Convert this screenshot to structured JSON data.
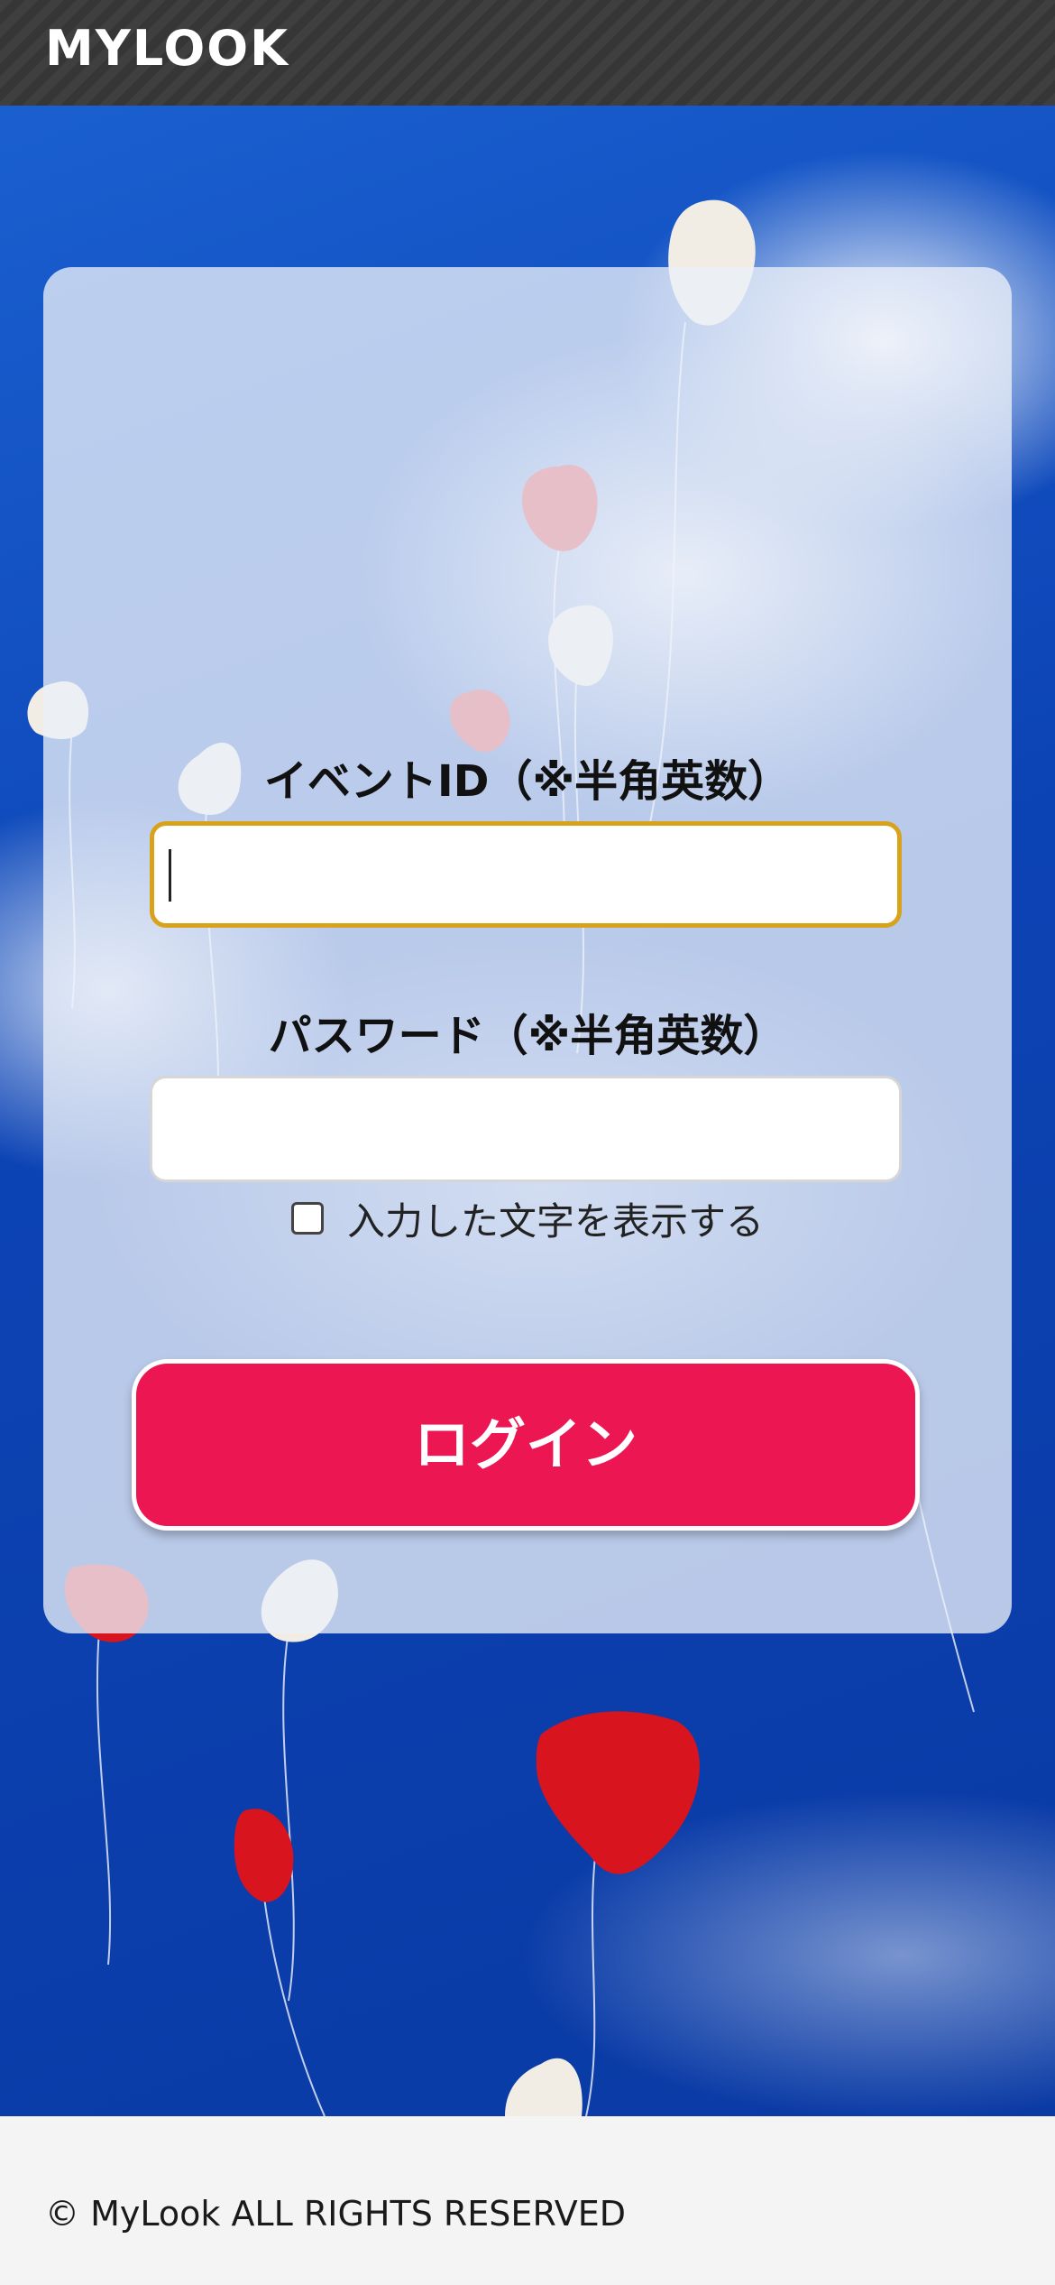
{
  "header": {
    "brand": "MYLOOK"
  },
  "form": {
    "event_id_label": "イベントID（※半角英数）",
    "event_id_value": "",
    "password_label": "パスワード（※半角英数）",
    "password_value": "",
    "show_password_label": "入力した文字を表示する",
    "show_password_checked": false,
    "login_label": "ログイン"
  },
  "footer": {
    "copyright": "© MyLook ALL RIGHTS RESERVED"
  },
  "colors": {
    "header_bg": "#3a3a3a",
    "login_button": "#ec1653",
    "focus_border": "#d9a21b",
    "sky": "#0d46b8"
  }
}
